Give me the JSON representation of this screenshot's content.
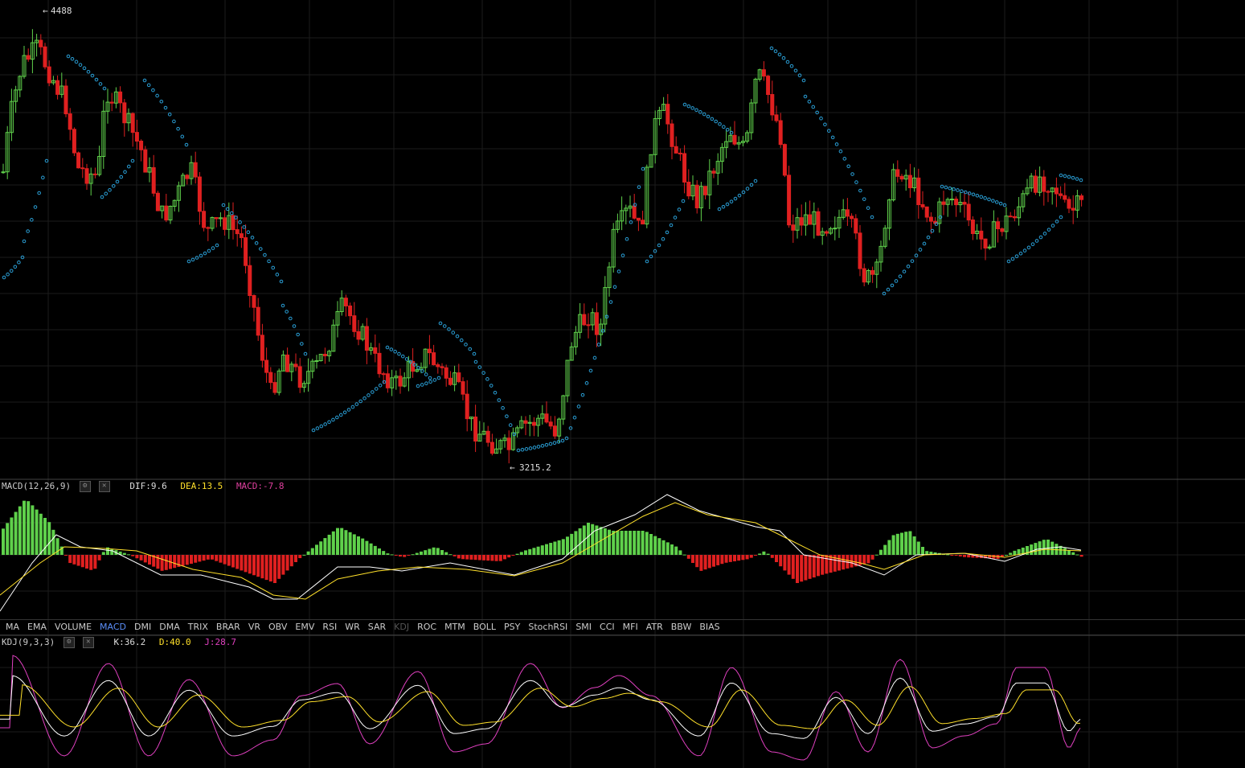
{
  "price_pane": {
    "max_label": "4488",
    "min_label": "3215.2",
    "colors": {
      "up": "#5fd14b",
      "down": "#e02020",
      "sar": "#2a9fd6",
      "grid": "#1c1c1c"
    }
  },
  "macd": {
    "title": "MACD(12,26,9)",
    "dif_label": "DIF:9.6",
    "dea_label": "DEA:13.5",
    "macd_label": "MACD:-7.8",
    "colors": {
      "dif": "#ffffff",
      "dea": "#ffe02a",
      "macd": "#e0409f"
    }
  },
  "indicator_tabs": [
    {
      "label": "MA",
      "state": "normal"
    },
    {
      "label": "EMA",
      "state": "normal"
    },
    {
      "label": "VOLUME",
      "state": "normal"
    },
    {
      "label": "MACD",
      "state": "active"
    },
    {
      "label": "DMI",
      "state": "normal"
    },
    {
      "label": "DMA",
      "state": "normal"
    },
    {
      "label": "TRIX",
      "state": "normal"
    },
    {
      "label": "BRAR",
      "state": "normal"
    },
    {
      "label": "VR",
      "state": "normal"
    },
    {
      "label": "OBV",
      "state": "normal"
    },
    {
      "label": "EMV",
      "state": "normal"
    },
    {
      "label": "RSI",
      "state": "normal"
    },
    {
      "label": "WR",
      "state": "normal"
    },
    {
      "label": "SAR",
      "state": "normal"
    },
    {
      "label": "KDJ",
      "state": "disabled"
    },
    {
      "label": "ROC",
      "state": "normal"
    },
    {
      "label": "MTM",
      "state": "normal"
    },
    {
      "label": "BOLL",
      "state": "normal"
    },
    {
      "label": "PSY",
      "state": "normal"
    },
    {
      "label": "StochRSI",
      "state": "normal"
    },
    {
      "label": "SMI",
      "state": "normal"
    },
    {
      "label": "CCI",
      "state": "normal"
    },
    {
      "label": "MFI",
      "state": "normal"
    },
    {
      "label": "ATR",
      "state": "normal"
    },
    {
      "label": "BBW",
      "state": "normal"
    },
    {
      "label": "BIAS",
      "state": "normal"
    }
  ],
  "kdj": {
    "title": "KDJ(9,3,3)",
    "k_label": "K:36.2",
    "d_label": "D:40.0",
    "j_label": "J:28.7",
    "colors": {
      "k": "#ffffff",
      "d": "#ffe02a",
      "j": "#e040c0"
    }
  },
  "icons": {
    "settings": "gear-icon",
    "close": "close-icon"
  }
}
